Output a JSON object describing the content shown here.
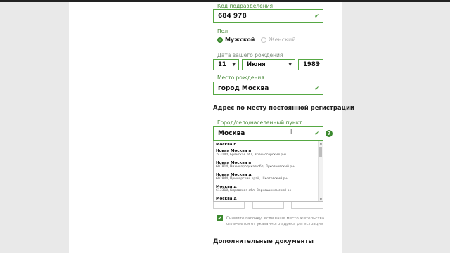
{
  "passport": {
    "division_code_label": "Код подразделения",
    "division_code_value": "684 978"
  },
  "gender": {
    "label": "Пол",
    "options": [
      "Мужской",
      "Женский"
    ],
    "selected": "Мужской"
  },
  "birth_date": {
    "label": "Дата вашего рождения",
    "day": "11",
    "month": "Июня",
    "year": "1983"
  },
  "birth_place": {
    "label": "Место рождения",
    "value": "город Москва"
  },
  "registration": {
    "section_title": "Адрес по месту постоянной регистрации",
    "city_label": "Город/село/населенный пункт",
    "city_value": "Москва",
    "help_icon": "?"
  },
  "suggestions": [
    {
      "name": "Москва г",
      "sub": ""
    },
    {
      "name": "Новая Москва п",
      "sub": "243140, Брянская обл, Красногорский р-н"
    },
    {
      "name": "Новая Москва п",
      "sub": "607814, Нижегородская обл, Лукояновский р-н"
    },
    {
      "name": "Новая Москва д",
      "sub": "692844, Приморский край, Шкотовский р-н"
    },
    {
      "name": "Москва д",
      "sub": "613310, Кировская обл, Верхошижемский р-н"
    },
    {
      "name": "Москва д",
      "sub": ""
    }
  ],
  "residence_checkbox": {
    "checked": true,
    "text": "Снимите галочку, если ваше место жительства отличается от указанного адреса регистрации"
  },
  "additional_docs": {
    "title": "Дополнительные документы"
  }
}
